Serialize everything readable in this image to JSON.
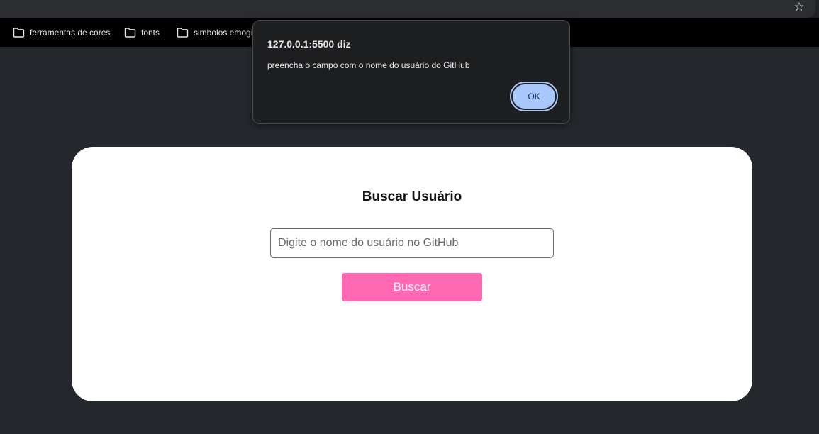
{
  "browser": {
    "bookmarks": [
      {
        "label": "ferramentas de cores"
      },
      {
        "label": "fonts"
      },
      {
        "label": "simbolos emogi"
      }
    ],
    "bookmark_star_icon": "star-icon",
    "folder_icon": "folder-icon"
  },
  "card": {
    "title": "Buscar Usuário",
    "search_placeholder": "Digite o nome do usuário no GitHub",
    "search_value": "",
    "button_label": "Buscar",
    "button_color": "#ff69b4"
  },
  "alert": {
    "title": "127.0.0.1:5500 diz",
    "message": "preencha o campo com o nome do usuário do GitHub",
    "ok_label": "OK",
    "ok_color": "#a8c7fa"
  },
  "colors": {
    "page_background": "#24282d",
    "card_background": "#ffffff",
    "dialog_background": "#1e1f21"
  }
}
